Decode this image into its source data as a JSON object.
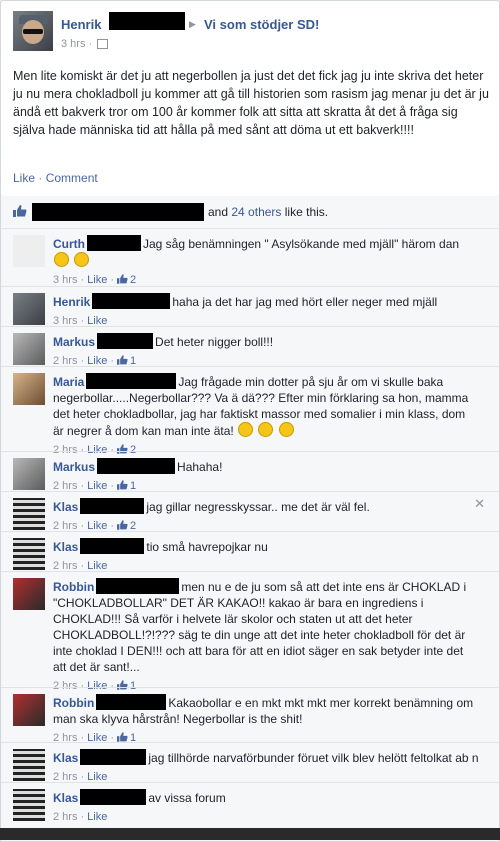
{
  "post": {
    "author": "Henrik",
    "group": "Vi som stödjer SD!",
    "time": "3 hrs",
    "text": "Men lite komiskt är det ju att negerbollen ja just det det fick jag ju inte skriva det heter ju nu mera chokladboll ju kommer att gå till historien som rasism jag menar ju det är ju ändå ett bakverk tror om 100 år kommer folk att sitta att skratta åt det å fråga sig själva hade människa tid att hålla på med sånt att döma ut ett bakverk!!!!",
    "like_label": "Like",
    "comment_label": "Comment",
    "separator": "·"
  },
  "likes": {
    "and_text": "and",
    "others_link": "24 others",
    "suffix": "like this."
  },
  "comments": [
    {
      "name": "Curth",
      "text": "Jag såg benämningen \" Asylsökande med mjäll\" härom dan",
      "emojis": 2,
      "time": "3 hrs",
      "like": "Like",
      "count": "2"
    },
    {
      "name": "Henrik",
      "text": "haha ja det har jag med hört eller neger med mjäll",
      "time": "3 hrs",
      "like": "Like",
      "count": ""
    },
    {
      "name": "Markus",
      "text": "Det heter nigger boll!!!",
      "time": "2 hrs",
      "like": "Like",
      "count": "1"
    },
    {
      "name": "Maria",
      "text": "Jag frågade min dotter på sju år om vi skulle baka negerbollar.....Negerbollar??? Va ä dä??? Efter min förklaring sa hon, mamma det heter chokladbollar, jag har faktiskt massor med somalier i min klass, dom är negrer å dom kan man inte äta!",
      "emojis": 3,
      "time": "2 hrs",
      "like": "Like",
      "count": "2"
    },
    {
      "name": "Markus",
      "text": "Hahaha!",
      "time": "2 hrs",
      "like": "Like",
      "count": "1"
    },
    {
      "name": "Klas",
      "text": "jag gillar negresskyssar.. me det är väl fel.",
      "time": "2 hrs",
      "like": "Like",
      "count": "2"
    },
    {
      "name": "Klas",
      "text": "tio små havrepojkar nu",
      "time": "2 hrs",
      "like": "Like",
      "count": ""
    },
    {
      "name": "Robbin",
      "text": "men nu e de ju som så att det inte ens är CHOKLAD i \"CHOKLADBOLLAR\" DET ÄR KAKAO!! kakao är bara en ingrediens i CHOKLAD!!! Så varför i helvete lär skolor och staten ut att det heter CHOKLADBOLL!?!??? säg te din unge att det inte heter chokladboll för det är inte choklad I DEN!!! och att bara för att en idiot säger en sak betyder inte det att det är sant!...",
      "time": "2 hrs",
      "like": "Like",
      "count": "1"
    },
    {
      "name": "Robbin",
      "text": "Kakaobollar e en mkt mkt mkt mer korrekt benämning om man ska klyva hårstrån! Negerbollar is the shit!",
      "time": "2 hrs",
      "like": "Like",
      "count": "1"
    },
    {
      "name": "Klas",
      "text": "jag tillhörde narvaförbunder föruet vilk blev helött feltolkat ab n",
      "time": "2 hrs",
      "like": "Like",
      "count": ""
    },
    {
      "name": "Klas",
      "text": "av vissa forum",
      "time": "2 hrs",
      "like": "Like",
      "count": ""
    }
  ],
  "colors": {
    "link": "#365899",
    "meta": "#90949c",
    "background": "#e9ebee",
    "redaction": "#000000"
  },
  "icons": [
    "avatar",
    "audience-icon",
    "like-thumb-icon",
    "close-icon",
    "emoji-icon"
  ]
}
